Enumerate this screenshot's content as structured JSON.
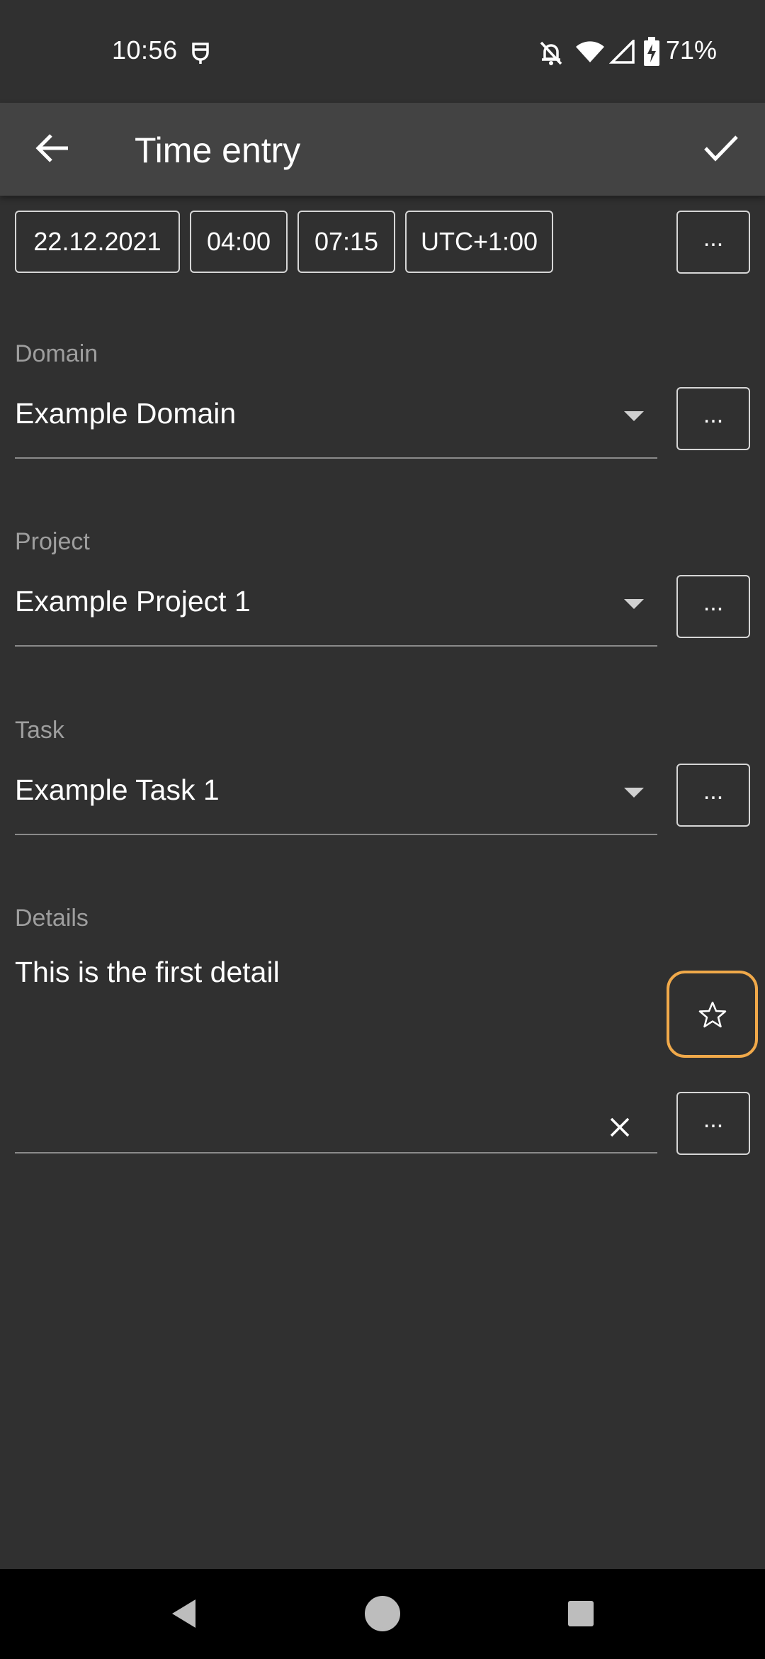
{
  "status_bar": {
    "time": "10:56",
    "battery": "71%",
    "icons": [
      "notification-icon",
      "silent-icon",
      "wifi-icon",
      "signal-icon",
      "battery-charging-icon"
    ]
  },
  "app_bar": {
    "title": "Time entry",
    "back_icon": "arrow-left-icon",
    "confirm_icon": "check-icon"
  },
  "time_row": {
    "date": "22.12.2021",
    "start": "04:00",
    "end": "07:15",
    "timezone": "UTC+1:00",
    "more": "..."
  },
  "domain": {
    "label": "Domain",
    "value": "Example Domain",
    "more": "..."
  },
  "project": {
    "label": "Project",
    "value": "Example Project 1",
    "more": "..."
  },
  "task": {
    "label": "Task",
    "value": "Example Task 1",
    "more": "..."
  },
  "details": {
    "label": "Details",
    "value": "This is the first detail",
    "favorite_icon": "star-outline-icon"
  },
  "extra_field": {
    "value": "",
    "clear_icon": "close-icon",
    "more": "..."
  },
  "colors": {
    "background": "#303030",
    "app_bar": "#434343",
    "accent_focus": "#f0a94a",
    "label": "#9e9e9e"
  }
}
